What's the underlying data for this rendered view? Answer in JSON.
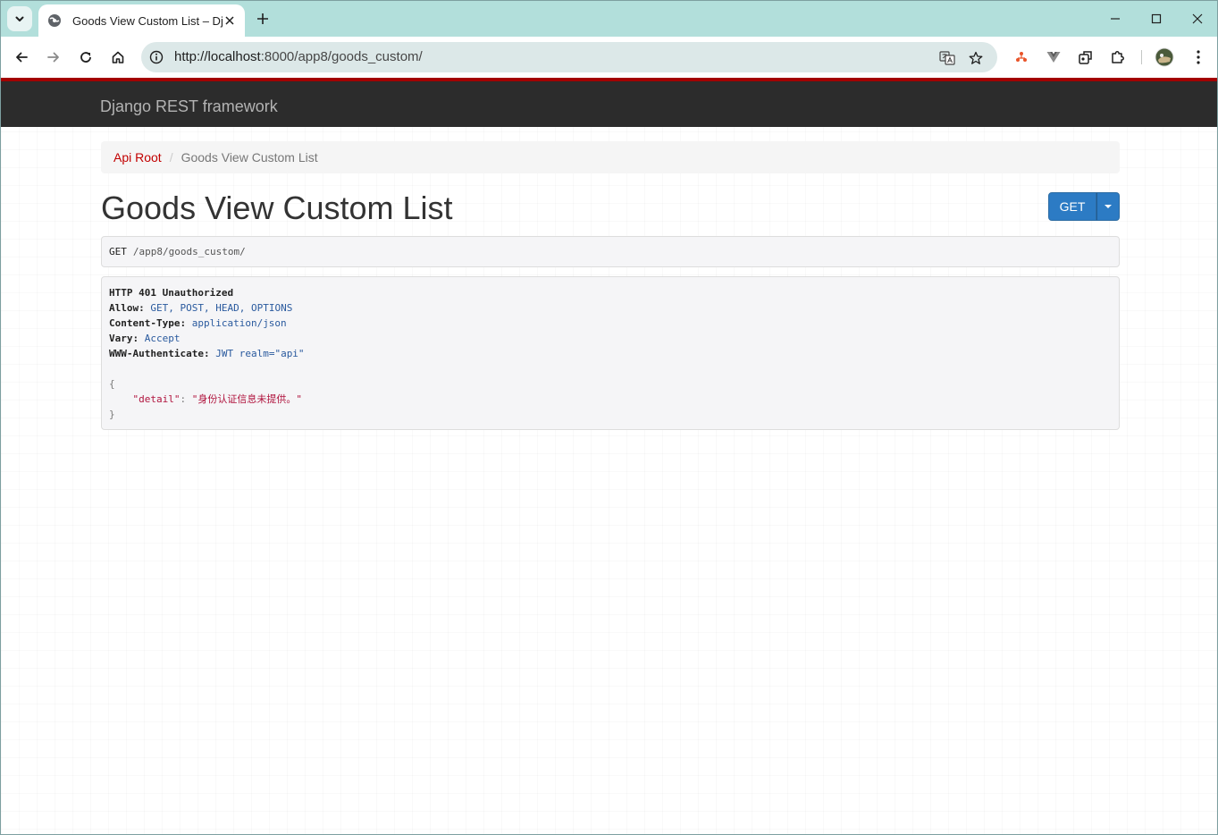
{
  "browser": {
    "tab_title": "Goods View Custom List – Dj",
    "url_host": "http://localhost",
    "url_rest": ":8000/app8/goods_custom/"
  },
  "page": {
    "brand": "Django REST framework",
    "breadcrumb": {
      "root": "Api Root",
      "divider": "/",
      "current": "Goods View Custom List"
    },
    "title": "Goods View Custom List",
    "get_button": "GET",
    "request": {
      "method": "GET",
      "path": "/app8/goods_custom/"
    },
    "response": {
      "status": "HTTP 401 Unauthorized",
      "headers": [
        {
          "name": "Allow:",
          "value": "GET, POST, HEAD, OPTIONS"
        },
        {
          "name": "Content-Type:",
          "value": "application/json"
        },
        {
          "name": "Vary:",
          "value": "Accept"
        },
        {
          "name": "WWW-Authenticate:",
          "value": "JWT realm=\"api\""
        }
      ],
      "body_open": "{",
      "body_key": "\"detail\"",
      "body_colon": ": ",
      "body_value": "\"身份认证信息未提供。\"",
      "body_close": "}"
    }
  },
  "colors": {
    "tab_strip": "#b2dfdb",
    "navbar": "#2c2c2c",
    "navbar_accent": "#a30000",
    "button": "#2c7bc4",
    "link": "#c20000"
  },
  "icons": [
    "tab-search-icon",
    "favicon-icon",
    "close-icon",
    "new-tab-icon",
    "minimize-icon",
    "maximize-icon",
    "window-close-icon",
    "back-icon",
    "forward-icon",
    "reload-icon",
    "home-icon",
    "site-info-icon",
    "translate-icon",
    "star-icon",
    "extension-icon",
    "profile-avatar"
  ]
}
